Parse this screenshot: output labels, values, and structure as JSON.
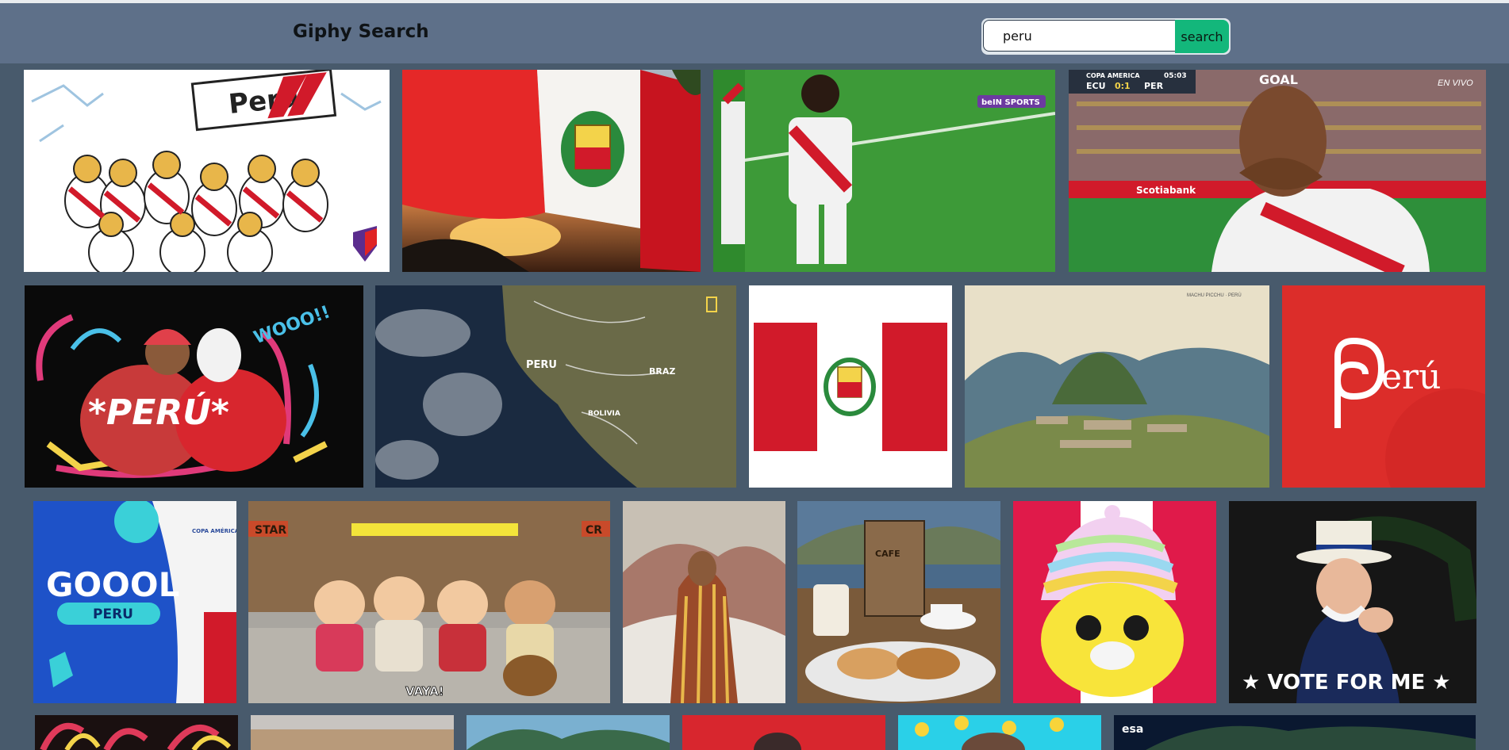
{
  "header": {
    "title": "Giphy Search",
    "search": {
      "value": "peru",
      "button_label": "search"
    }
  },
  "gifs": {
    "cheer": {
      "banner": "Perú"
    },
    "soccer1": {
      "channel": "beIN SPORTS"
    },
    "soccer2": {
      "overlay_live": "EN VIVO",
      "goal": "GOAL",
      "score_left": "ECU",
      "score": "0:1",
      "score_right": "PER",
      "clock": "05:03",
      "competition": "COPA AMERICA",
      "sponsor": "Scotiabank"
    },
    "dancers": {
      "caption": "*PERÚ*",
      "shout": "WOOO!!"
    },
    "map": {
      "country1": "PERU",
      "country2": "BRAZ",
      "country3": "BOLIVIA"
    },
    "machu": {
      "watermark": "MACHU PICCHU · PERÚ"
    },
    "brand": {
      "logo_text": "erú"
    },
    "goool": {
      "main": "GOOOL",
      "sub": "PERU",
      "badge": "COPA AMÉRICA"
    },
    "southpark": {
      "caption": "VAYA!",
      "sign_left": "STAR",
      "sign_right": "CR"
    },
    "coffee": {
      "label": "CAFE"
    },
    "vote": {
      "caption": "★ VOTE FOR ME ★"
    },
    "esa": {
      "label": "esa"
    }
  },
  "colors": {
    "background": "#485a6c",
    "header": "#5e7089",
    "accent": "#13b77b",
    "peru_red": "#d11a2a"
  }
}
